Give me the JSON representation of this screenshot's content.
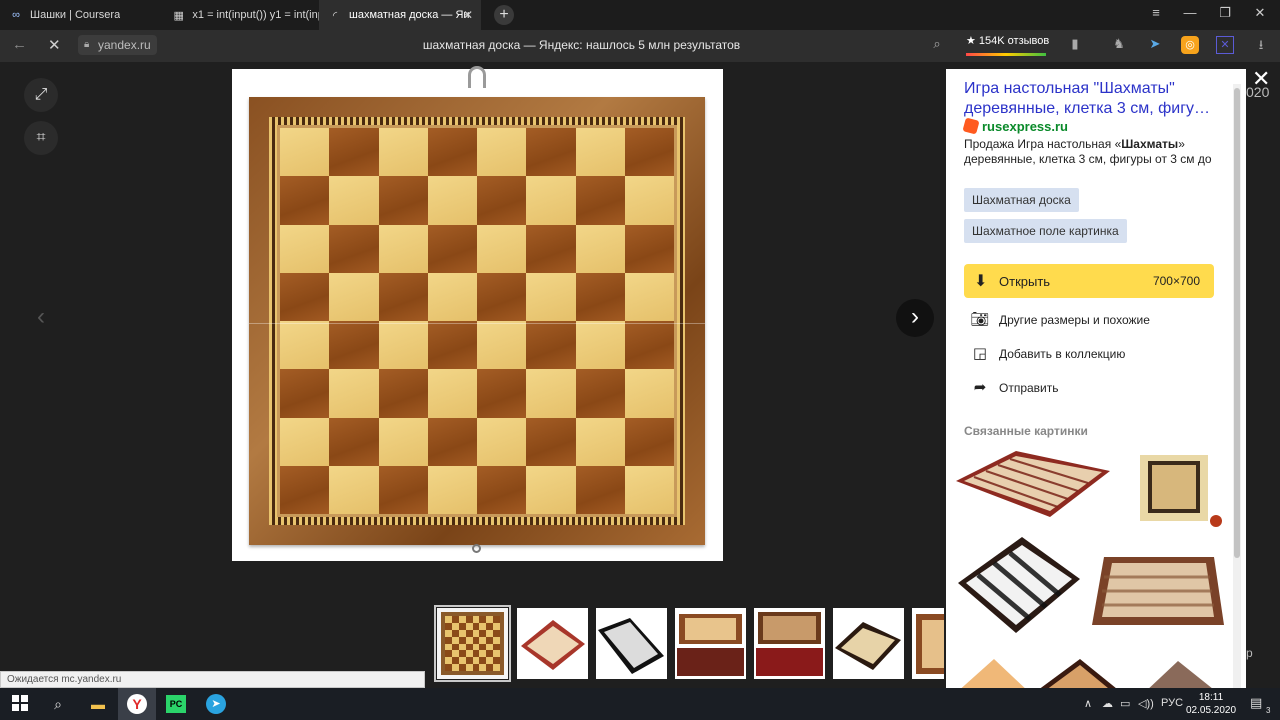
{
  "browser": {
    "tabs": [
      {
        "label": "Шашки | Coursera",
        "icon": "infinity-icon",
        "active": false
      },
      {
        "label": "x1 = int(input()) y1 = int(inp",
        "icon": "code-icon",
        "active": false
      },
      {
        "label": "шахматная доска — Ян",
        "icon": "loading-icon",
        "active": true
      }
    ],
    "new_tab": "+",
    "url": "yandex.ru",
    "page_title": "шахматная доска — Яндекс: нашлось 5 млн результатов",
    "reviews_badge": "★ 154K отзывов",
    "window_controls": [
      "≡",
      "—",
      "❐",
      "✕"
    ]
  },
  "viewer": {
    "tools": [
      "expand-icon",
      "crop-icon"
    ],
    "prev_arrow": "‹",
    "next_arrow": "›",
    "main_image": {
      "squares_per_side": 8
    },
    "thumbnails": [
      {
        "style": "wood-frame",
        "selected": true
      },
      {
        "style": "red-diamond"
      },
      {
        "style": "black-white"
      },
      {
        "style": "box-open"
      },
      {
        "style": "box-red"
      },
      {
        "style": "cream-diamond"
      },
      {
        "style": "partial"
      }
    ],
    "status_text": "Ожидается mc.yandex.ru"
  },
  "panel": {
    "title": "Игра настольная \"Шахматы\" деревянные, клетка 3 см, фигу…",
    "site": "rusexpress.ru",
    "description_prefix": "Продажа Игра настольная «",
    "description_bold": "Шахматы",
    "description_suffix": "» деревянные, клетка 3 см, фигуры от 3 см до",
    "chips": [
      "Шахматная доска",
      "Шахматное поле картинка"
    ],
    "open_label": "Открыть",
    "open_size": "700×700",
    "actions": [
      {
        "label": "Другие размеры и похожие",
        "icon": "camera-icon"
      },
      {
        "label": "Добавить в коллекцию",
        "icon": "bookmark-icon"
      },
      {
        "label": "Отправить",
        "icon": "share-icon"
      }
    ],
    "related_title": "Связанные картинки",
    "close": "✕",
    "background_date_fragment": "020",
    "background_p_fragment": "р"
  },
  "taskbar": {
    "lang": "РУС",
    "time": "18:11",
    "date": "02.05.2020",
    "notification_count": "3",
    "icons": [
      "windows-start-icon",
      "search-icon",
      "file-explorer-icon",
      "yandex-browser-icon",
      "pycharm-icon",
      "telegram-icon"
    ]
  },
  "colors": {
    "accent_yellow": "#ffdb4d",
    "link_blue": "#2c33c9",
    "site_green": "#0a8a2a"
  }
}
